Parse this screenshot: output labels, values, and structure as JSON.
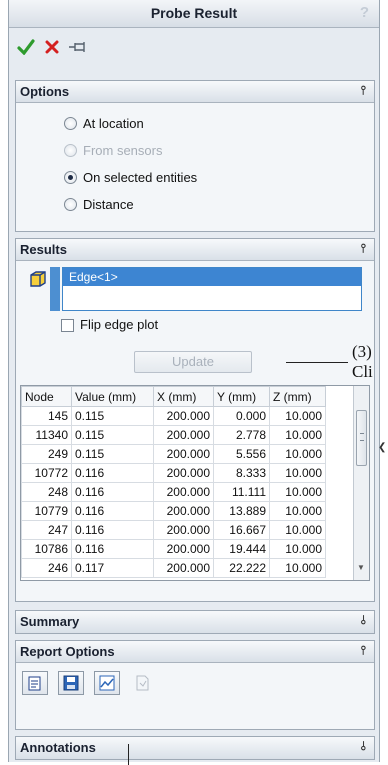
{
  "panel": {
    "title": "Probe Result",
    "help": "?"
  },
  "options": {
    "title": "Options",
    "items": [
      {
        "label": "At location",
        "checked": false,
        "disabled": false
      },
      {
        "label": "From sensors",
        "checked": false,
        "disabled": true
      },
      {
        "label": "On selected entities",
        "checked": true,
        "disabled": false
      },
      {
        "label": "Distance",
        "checked": false,
        "disabled": false
      }
    ]
  },
  "results": {
    "title": "Results",
    "selection": "Edge<1>",
    "flip_label": "Flip edge plot",
    "update_label": "Update",
    "columns": [
      "Node",
      "Value (mm)",
      "X (mm)",
      "Y (mm)",
      "Z (mm)"
    ],
    "rows": [
      [
        "145",
        "0.115",
        "200.000",
        "0.000",
        "10.000"
      ],
      [
        "11340",
        "0.115",
        "200.000",
        "2.778",
        "10.000"
      ],
      [
        "249",
        "0.115",
        "200.000",
        "5.556",
        "10.000"
      ],
      [
        "10772",
        "0.116",
        "200.000",
        "8.333",
        "10.000"
      ],
      [
        "248",
        "0.116",
        "200.000",
        "11.111",
        "10.000"
      ],
      [
        "10779",
        "0.116",
        "200.000",
        "13.889",
        "10.000"
      ],
      [
        "247",
        "0.116",
        "200.000",
        "16.667",
        "10.000"
      ],
      [
        "10786",
        "0.116",
        "200.000",
        "19.444",
        "10.000"
      ],
      [
        "246",
        "0.117",
        "200.000",
        "22.222",
        "10.000"
      ]
    ]
  },
  "summary": {
    "title": "Summary"
  },
  "report_options": {
    "title": "Report Options"
  },
  "annotations": {
    "title": "Annotations"
  },
  "callout": {
    "line1": "(3)",
    "line2": "Cli"
  },
  "colors": {
    "accent": "#3d85d2",
    "ok": "#2e9b2e",
    "cancel": "#d42020"
  }
}
